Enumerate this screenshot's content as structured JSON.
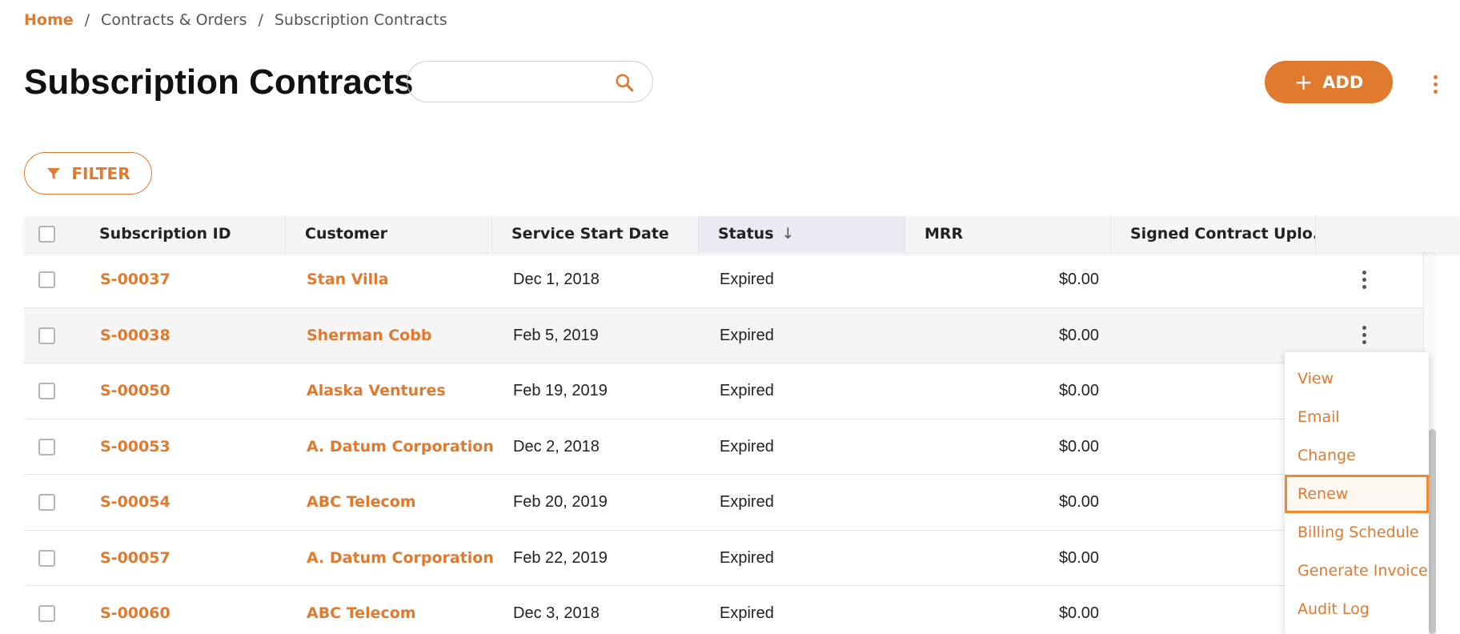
{
  "breadcrumb": {
    "home": "Home",
    "separator": "/",
    "level1": "Contracts & Orders",
    "level2": "Subscription Contracts"
  },
  "page": {
    "title": "Subscription Contracts"
  },
  "search": {
    "value": "",
    "placeholder": "",
    "icon": "search-icon"
  },
  "toolbar": {
    "add_label": "ADD",
    "add_icon": "plus-icon",
    "more_icon": "kebab-icon",
    "filter_label": "FILTER",
    "filter_icon": "funnel-icon"
  },
  "colors": {
    "accent": "#e07a2f",
    "header_bg": "#f5f5f8",
    "sorted_header_bg": "#e9eaf2"
  },
  "table": {
    "columns": [
      {
        "label": "Subscription ID"
      },
      {
        "label": "Customer"
      },
      {
        "label": "Service Start Date"
      },
      {
        "label": "Status",
        "sort": "descending"
      },
      {
        "label": "MRR"
      },
      {
        "label": "Signed Contract Uplo..."
      }
    ],
    "rows": [
      {
        "id": "S-00037",
        "customer": "Stan Villa",
        "start": "Dec 1, 2018",
        "status": "Expired",
        "mrr": "$0.00"
      },
      {
        "id": "S-00038",
        "customer": "Sherman Cobb",
        "start": "Feb 5, 2019",
        "status": "Expired",
        "mrr": "$0.00"
      },
      {
        "id": "S-00050",
        "customer": "Alaska Ventures",
        "start": "Feb 19, 2019",
        "status": "Expired",
        "mrr": "$0.00"
      },
      {
        "id": "S-00053",
        "customer": "A. Datum Corporation",
        "start": "Dec 2, 2018",
        "status": "Expired",
        "mrr": "$0.00"
      },
      {
        "id": "S-00054",
        "customer": "ABC Telecom",
        "start": "Feb 20, 2019",
        "status": "Expired",
        "mrr": "$0.00"
      },
      {
        "id": "S-00057",
        "customer": "A. Datum Corporation",
        "start": "Feb 22, 2019",
        "status": "Expired",
        "mrr": "$0.00"
      },
      {
        "id": "S-00060",
        "customer": "ABC Telecom",
        "start": "Dec 3, 2018",
        "status": "Expired",
        "mrr": "$0.00"
      }
    ]
  },
  "row_menu": {
    "items": [
      "View",
      "Email",
      "Change",
      "Renew",
      "Billing Schedule",
      "Generate Invoice",
      "Audit Log"
    ],
    "selected": "Renew"
  }
}
